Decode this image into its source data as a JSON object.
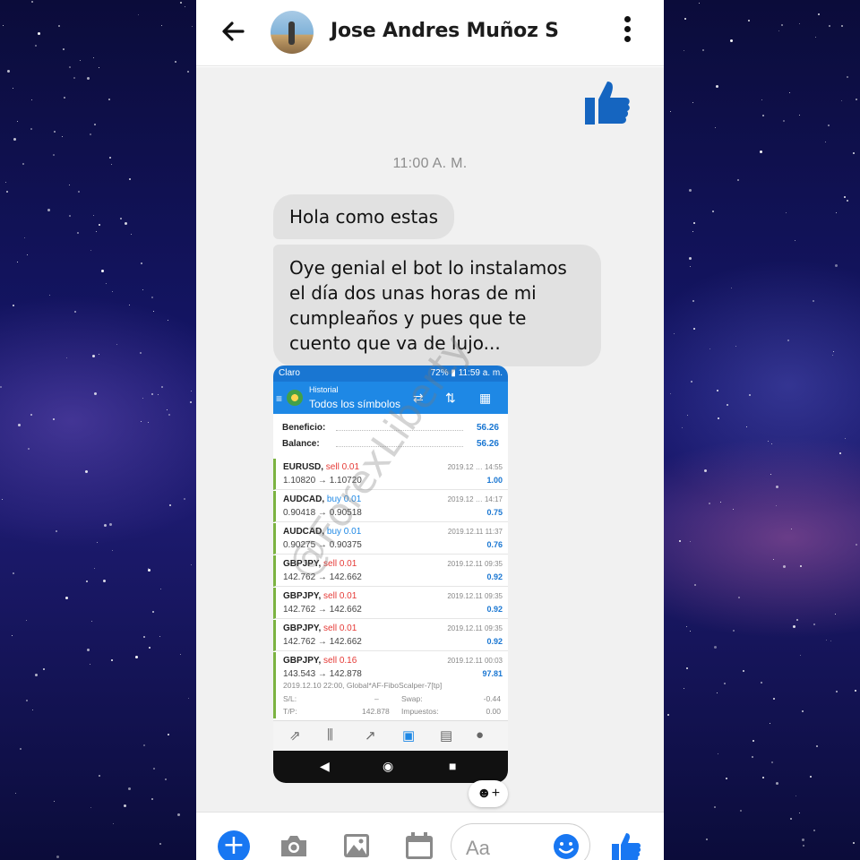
{
  "header": {
    "contact_name": "Jose Andres Muñoz S",
    "icons": [
      "back-arrow-icon",
      "avatar",
      "more-vertical-icon"
    ]
  },
  "thread": {
    "sent_reaction": "thumbs-up",
    "timestamp": "11:00 A. M.",
    "messages": [
      {
        "text": "Hola como estas"
      },
      {
        "text": "Oye genial el bot lo instalamos el día dos unas horas de mi cumpleaños y pues que te cuento que va de lujo..."
      }
    ],
    "watermark": "@ForexLiberty",
    "react_label": "☻+"
  },
  "attachment": {
    "status_left": "Claro",
    "status_right": "72% ▮ 11:59 a. m.",
    "title_small": "Historial",
    "title": "Todos los símbolos",
    "summary": [
      {
        "label": "Beneficio:",
        "value": "56.26"
      },
      {
        "label": "Balance:",
        "value": "56.26"
      }
    ],
    "trades": [
      {
        "symbol": "EURUSD,",
        "side": "sell",
        "lot": "sell 0.01",
        "prices": "1.10820 → 1.10720",
        "date": "2019.12 … 14:55",
        "profit": "1.00"
      },
      {
        "symbol": "AUDCAD,",
        "side": "buy",
        "lot": "buy 0.01",
        "prices": "0.90418 → 0.90518",
        "date": "2019.12 … 14:17",
        "profit": "0.75"
      },
      {
        "symbol": "AUDCAD,",
        "side": "buy",
        "lot": "buy 0.01",
        "prices": "0.90275 → 0.90375",
        "date": "2019.12.11 11:37",
        "profit": "0.76"
      },
      {
        "symbol": "GBPJPY,",
        "side": "sell",
        "lot": "sell 0.01",
        "prices": "142.762 → 142.662",
        "date": "2019.12.11 09:35",
        "profit": "0.92"
      },
      {
        "symbol": "GBPJPY,",
        "side": "sell",
        "lot": "sell 0.01",
        "prices": "142.762 → 142.662",
        "date": "2019.12.11 09:35",
        "profit": "0.92"
      },
      {
        "symbol": "GBPJPY,",
        "side": "sell",
        "lot": "sell 0.01",
        "prices": "142.762 → 142.662",
        "date": "2019.12.11 09:35",
        "profit": "0.92"
      },
      {
        "symbol": "GBPJPY,",
        "side": "sell",
        "lot": "sell 0.16",
        "prices": "143.543 → 142.878",
        "date": "2019.12.11 00:03",
        "profit": "97.81"
      }
    ],
    "detail": {
      "comment": "2019.12.10 22:00, Global*AF-FiboScalper-7[tp]",
      "sl_label": "S/L:",
      "sl_value": "–",
      "swap_label": "Swap:",
      "swap_value": "-0.44",
      "tp_label": "T/P:",
      "tp_value": "142.878",
      "fees_label": "Impuestos:",
      "fees_value": "0.00"
    }
  },
  "composer": {
    "placeholder": "Aa",
    "icons": [
      "plus-icon",
      "camera-icon",
      "image-icon",
      "calendar-icon",
      "emoji-icon",
      "thumbs-up-icon"
    ]
  },
  "colors": {
    "accent": "#1877f2",
    "bubble": "#e1e1e1",
    "thread_bg": "#f1f1f1",
    "mt4_blue": "#1e88e5",
    "sell_red": "#e53935"
  }
}
